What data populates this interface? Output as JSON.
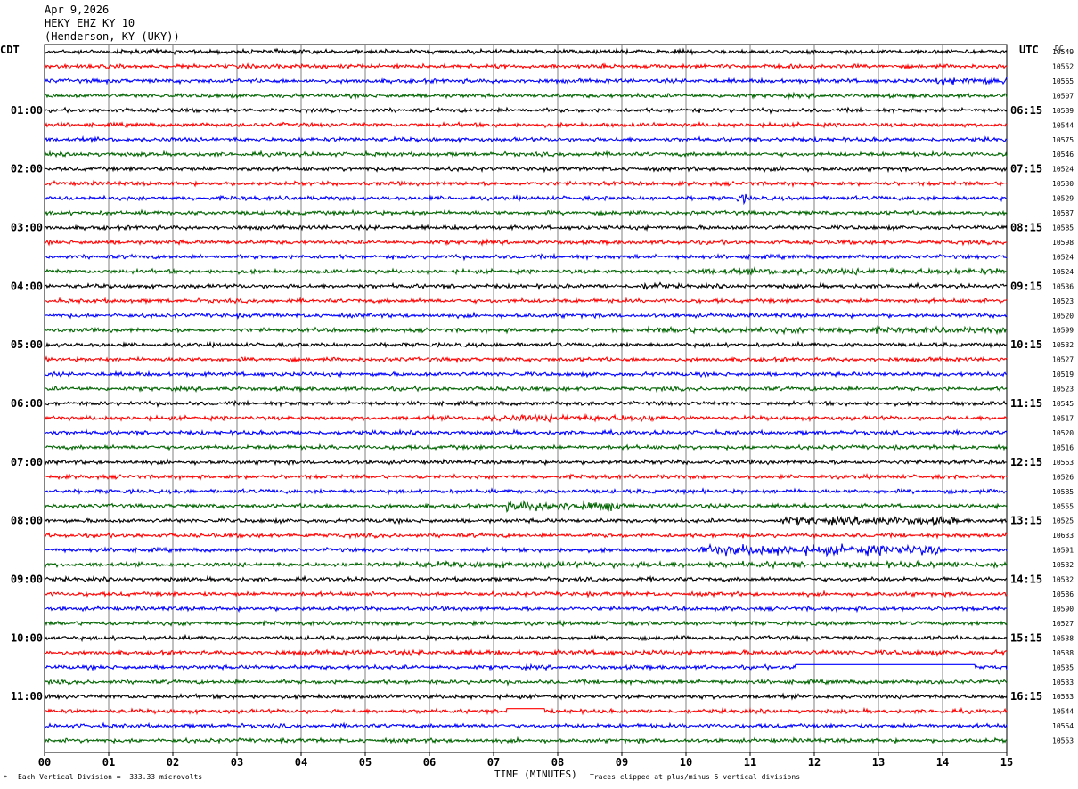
{
  "header": {
    "date": "Apr 9,2026",
    "station": "HEKY EHZ KY 10",
    "location": "(Henderson, KY (UKY))"
  },
  "left_timezone": "CDT",
  "right_timezone": "UTC",
  "dc_label": "DC",
  "footer": {
    "scale_note": "Each Vertical Division =  333.33 microvolts",
    "xlabel": "TIME (MINUTES)",
    "clip_note": "Traces clipped at plus/minus 5 vertical divisions"
  },
  "colors": {
    "trace_cycle": [
      "#000000",
      "#ff0000",
      "#0000ff",
      "#006400"
    ],
    "grid": "#808080"
  },
  "chart_data": {
    "type": "line",
    "title": "HEKY EHZ KY 10",
    "xlabel": "TIME (MINUTES)",
    "xlim": [
      0,
      15
    ],
    "x_ticks": [
      "00",
      "01",
      "02",
      "03",
      "04",
      "05",
      "06",
      "07",
      "08",
      "09",
      "10",
      "11",
      "12",
      "13",
      "14",
      "15"
    ],
    "trace_count": 48,
    "left_hour_labels": [
      {
        "row": 4,
        "label": "01:00"
      },
      {
        "row": 8,
        "label": "02:00"
      },
      {
        "row": 12,
        "label": "03:00"
      },
      {
        "row": 16,
        "label": "04:00"
      },
      {
        "row": 20,
        "label": "05:00"
      },
      {
        "row": 24,
        "label": "06:00"
      },
      {
        "row": 28,
        "label": "07:00"
      },
      {
        "row": 32,
        "label": "08:00"
      },
      {
        "row": 36,
        "label": "09:00"
      },
      {
        "row": 40,
        "label": "10:00"
      },
      {
        "row": 44,
        "label": "11:00"
      }
    ],
    "right_hour_labels": [
      {
        "row": 4,
        "label": "06:15"
      },
      {
        "row": 8,
        "label": "07:15"
      },
      {
        "row": 12,
        "label": "08:15"
      },
      {
        "row": 16,
        "label": "09:15"
      },
      {
        "row": 20,
        "label": "10:15"
      },
      {
        "row": 24,
        "label": "11:15"
      },
      {
        "row": 28,
        "label": "12:15"
      },
      {
        "row": 32,
        "label": "13:15"
      },
      {
        "row": 36,
        "label": "14:15"
      },
      {
        "row": 40,
        "label": "15:15"
      },
      {
        "row": 44,
        "label": "16:15"
      }
    ],
    "dc_offsets": [
      "10549",
      "10552",
      "10565",
      "10507",
      "10589",
      "10544",
      "10575",
      "10546",
      "10524",
      "10530",
      "10529",
      "10587",
      "10585",
      "10598",
      "10524",
      "10524",
      "10536",
      "10523",
      "10520",
      "10599",
      "10532",
      "10527",
      "10519",
      "10523",
      "10545",
      "10517",
      "10520",
      "10516",
      "10563",
      "10526",
      "10585",
      "10555",
      "10525",
      "10633",
      "10591",
      "10532",
      "10532",
      "10586",
      "10590",
      "10527",
      "10538",
      "10538",
      "10535",
      "10533",
      "10533",
      "10544",
      "10554",
      "10553"
    ],
    "events": [
      {
        "row": 2,
        "x_start": 13.8,
        "x_end": 15.0,
        "amp": 1.8
      },
      {
        "row": 10,
        "x_start": 10.8,
        "x_end": 11.0,
        "amp": 2.2
      },
      {
        "row": 15,
        "x_start": 10.0,
        "x_end": 15.0,
        "amp": 1.5
      },
      {
        "row": 16,
        "x_start": 9.3,
        "x_end": 9.7,
        "amp": 1.8
      },
      {
        "row": 19,
        "x_start": 9.4,
        "x_end": 15.0,
        "amp": 1.5
      },
      {
        "row": 25,
        "x_start": 6.8,
        "x_end": 9.6,
        "amp": 1.7
      },
      {
        "row": 31,
        "x_start": 7.2,
        "x_end": 9.0,
        "amp": 2.4
      },
      {
        "row": 32,
        "x_start": 11.5,
        "x_end": 14.2,
        "amp": 2.0
      },
      {
        "row": 34,
        "x_start": 10.2,
        "x_end": 14.0,
        "amp": 2.5
      },
      {
        "row": 35,
        "x_start": 5.5,
        "x_end": 15.0,
        "amp": 1.5
      },
      {
        "row": 41,
        "x_start": 3.2,
        "x_end": 15.0,
        "amp": 1.2
      }
    ],
    "flat_segments": [
      {
        "row": 42,
        "x_start": 11.7,
        "x_end": 14.5
      },
      {
        "row": 45,
        "x_start": 7.2,
        "x_end": 7.8
      }
    ]
  }
}
